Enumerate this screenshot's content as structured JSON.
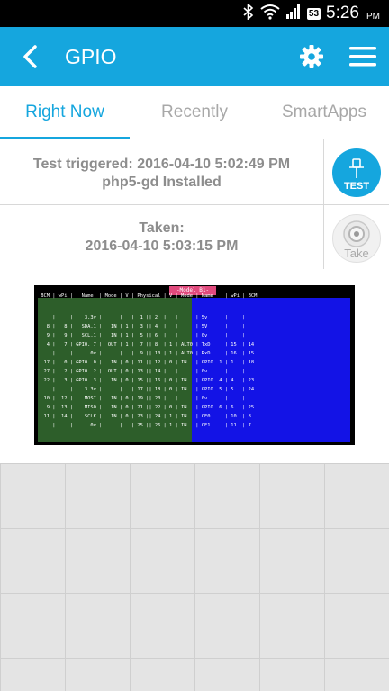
{
  "status_bar": {
    "time": "5:26",
    "ampm": "PM",
    "battery": "53"
  },
  "app_bar": {
    "title": "GPIO"
  },
  "tabs": [
    {
      "label": "Right Now",
      "active": true
    },
    {
      "label": "Recently",
      "active": false
    },
    {
      "label": "SmartApps",
      "active": false
    }
  ],
  "events": [
    {
      "line1": "Test triggered: 2016-04-10 5:02:49 PM",
      "line2": "php5-gd Installed",
      "icon": "pin-test-icon",
      "icon_label": "TEST"
    },
    {
      "line1": "Taken:",
      "line2": "2016-04-10 5:03:15 PM",
      "icon": "camera-lens-icon",
      "icon_label": "Take"
    }
  ],
  "terminal": {
    "banner": "-Model B1-",
    "header": " BCM | wPi |   Name  | Mode | V | Physical | V | Mode | Name    | wPi | BCM ",
    "rows": [
      "     |     |    3.3v |      |   |  1 || 2  |   |      | 5v      |     |     ",
      "   8 |   8 |   SDA.1 |   IN | 1 |  3 || 4  |   |      | 5V      |     |     ",
      "   9 |   9 |   SCL.1 |   IN | 1 |  5 || 6  |   |      | 0v      |     |     ",
      "   4 |   7 | GPIO. 7 |  OUT | 1 |  7 || 8  | 1 | ALT0 | TxD     | 15  | 14  ",
      "     |     |      0v |      |   |  9 || 10 | 1 | ALT0 | RxD     | 16  | 15  ",
      "  17 |   0 | GPIO. 0 |   IN | 0 | 11 || 12 | 0 | IN   | GPIO. 1 | 1   | 18  ",
      "  27 |   2 | GPIO. 2 |  OUT | 0 | 13 || 14 |   |      | 0v      |     |     ",
      "  22 |   3 | GPIO. 3 |   IN | 0 | 15 || 16 | 0 | IN   | GPIO. 4 | 4   | 23  ",
      "     |     |    3.3v |      |   | 17 || 18 | 0 | IN   | GPIO. 5 | 5   | 24  ",
      "  10 |  12 |    MOSI |   IN | 0 | 19 || 20 |   |      | 0v      |     |     ",
      "   9 |  13 |    MISO |   IN | 0 | 21 || 22 | 0 | IN   | GPIO. 6 | 6   | 25  ",
      "  11 |  14 |    SCLK |   IN | 0 | 23 || 24 | 1 | IN   | CE0     | 10  | 8   ",
      "     |     |      0v |      |   | 25 || 26 | 1 | IN   | CE1     | 11  | 7   "
    ]
  },
  "colors": {
    "accent": "#15a6de",
    "appbar": "#15a6de",
    "term_left": "#2d5e2a",
    "term_right": "#1313e6",
    "banner": "#e04a7d"
  }
}
